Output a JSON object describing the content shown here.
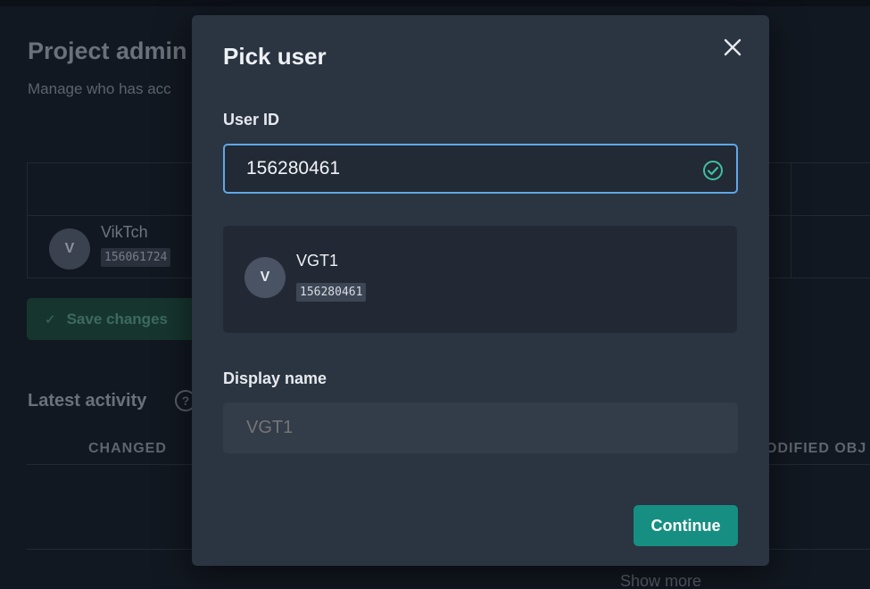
{
  "background": {
    "title": "Project admin",
    "subtitle": "Manage who has acc",
    "table": {
      "row": {
        "avatar_letter": "V",
        "name": "VikTch",
        "id": "156061724"
      }
    },
    "save_button_label": "Save changes",
    "latest_activity_label": "Latest activity",
    "help_icon_glyph": "?",
    "columns": {
      "changed": "CHANGED",
      "modified": "ODIFIED OBJ"
    },
    "show_more_label": "Show more"
  },
  "modal": {
    "title": "Pick user",
    "close_icon": "close-icon",
    "user_id": {
      "label": "User ID",
      "value": "156280461",
      "valid_icon": "check-circle-icon",
      "valid_color": "#3fbfa0"
    },
    "user_card": {
      "avatar_letter": "V",
      "name": "VGT1",
      "id": "156280461"
    },
    "display_name": {
      "label": "Display name",
      "placeholder": "VGT1"
    },
    "continue_label": "Continue",
    "accent_color": "#168f82"
  }
}
